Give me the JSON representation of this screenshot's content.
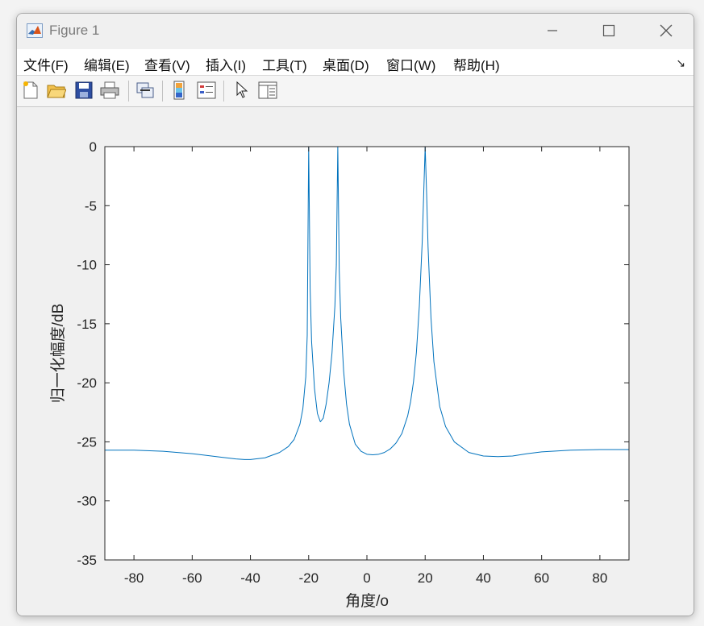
{
  "window": {
    "title": "Figure 1",
    "minimize_icon": "minimize-icon",
    "maximize_icon": "maximize-icon",
    "close_icon": "close-icon"
  },
  "menu": {
    "items": [
      "文件(F)",
      "编辑(E)",
      "查看(V)",
      "插入(I)",
      "工具(T)",
      "桌面(D)",
      "窗口(W)",
      "帮助(H)"
    ]
  },
  "toolbar": {
    "buttons": [
      "new-figure-icon",
      "open-file-icon",
      "save-icon",
      "print-icon",
      "link-plot-icon",
      "colorbar-icon",
      "legend-icon",
      "pointer-icon",
      "property-inspector-icon"
    ]
  },
  "chart_data": {
    "type": "line",
    "xlabel": "角度/o",
    "ylabel": "归一化幅度/dB",
    "xlim": [
      -90,
      90
    ],
    "ylim": [
      -35,
      0
    ],
    "xticks": [
      -80,
      -60,
      -40,
      -20,
      0,
      20,
      40,
      60,
      80
    ],
    "yticks": [
      0,
      -5,
      -10,
      -15,
      -20,
      -25,
      -30,
      -35
    ],
    "grid": false,
    "line_color": "#0072bd",
    "series": [
      {
        "x": [
          -90,
          -80,
          -70,
          -60,
          -50,
          -45,
          -42,
          -40,
          -35,
          -30,
          -27,
          -25,
          -23,
          -22,
          -21,
          -20.5,
          -20,
          -19.5,
          -19,
          -18,
          -17,
          -16,
          -15,
          -14,
          -13,
          -12,
          -11,
          -10.5,
          -10,
          -9.5,
          -9,
          -8,
          -7,
          -6,
          -4,
          -2,
          0,
          2,
          4,
          6,
          8,
          10,
          12,
          14,
          15,
          16,
          17,
          18,
          19,
          19.5,
          20,
          20.5,
          21,
          22,
          23,
          25,
          27,
          30,
          35,
          40,
          45,
          50,
          55,
          60,
          70,
          80,
          90
        ],
        "y": [
          -25.7,
          -25.7,
          -25.8,
          -26,
          -26.3,
          -26.45,
          -26.5,
          -26.5,
          -26.35,
          -25.9,
          -25.4,
          -24.8,
          -23.5,
          -22.2,
          -19.5,
          -16,
          0,
          -12,
          -16.5,
          -20.5,
          -22.6,
          -23.3,
          -23,
          -21.8,
          -20,
          -17.5,
          -13.5,
          -10,
          0,
          -10.5,
          -14.5,
          -19,
          -21.8,
          -23.5,
          -25.2,
          -25.8,
          -26.05,
          -26.1,
          -26.05,
          -25.9,
          -25.6,
          -25.1,
          -24.3,
          -22.8,
          -21.6,
          -19.9,
          -17.4,
          -13.5,
          -8,
          -4,
          0,
          -4,
          -8.5,
          -14.5,
          -18.2,
          -22,
          -23.7,
          -25,
          -25.9,
          -26.2,
          -26.25,
          -26.2,
          -26,
          -25.85,
          -25.7,
          -25.65,
          -25.65
        ]
      }
    ]
  }
}
